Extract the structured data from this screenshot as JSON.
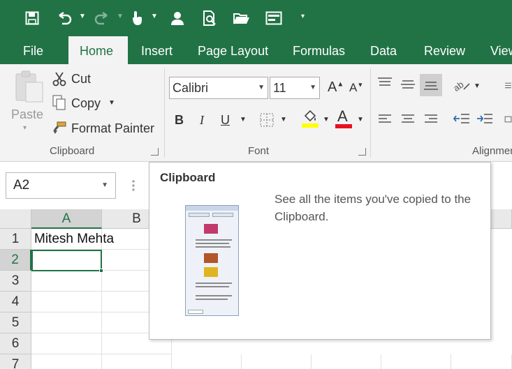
{
  "tabs": [
    "File",
    "Home",
    "Insert",
    "Page Layout",
    "Formulas",
    "Data",
    "Review",
    "View"
  ],
  "active_tab": "Home",
  "clipboard_group": {
    "label": "Clipboard",
    "paste_label": "Paste",
    "cut_label": "Cut",
    "copy_label": "Copy",
    "format_painter_label": "Format Painter"
  },
  "font_group": {
    "label": "Font",
    "font_name": "Calibri",
    "font_size": "11",
    "bold": "B",
    "italic": "I",
    "underline": "U",
    "font_color": "A",
    "grow_font": "A",
    "shrink_font": "A"
  },
  "alignment_group": {
    "label": "Alignment"
  },
  "name_box": "A2",
  "columns": [
    "A",
    "B"
  ],
  "rows": [
    "1",
    "2",
    "3",
    "4",
    "5",
    "6",
    "7"
  ],
  "cells": {
    "A1": "Mitesh Mehta"
  },
  "tooltip": {
    "title": "Clipboard",
    "description": "See all the items you've copied to the Clipboard."
  },
  "colors": {
    "excel_green": "#217346",
    "highlight_yellow": "#ffff00",
    "font_red": "#e81123"
  }
}
